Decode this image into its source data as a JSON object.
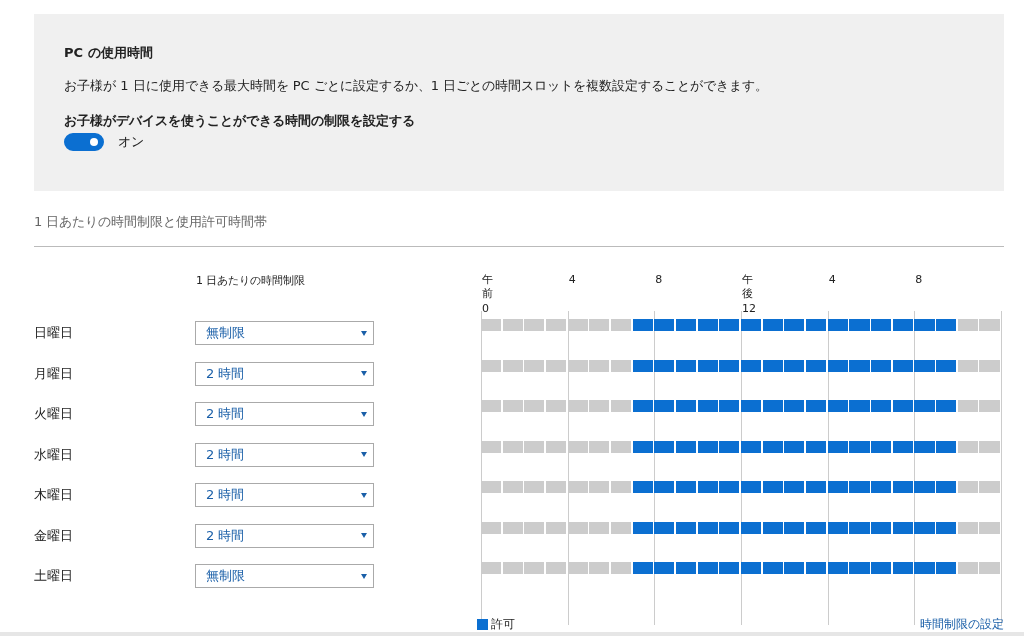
{
  "panel": {
    "title": "PC の使用時間",
    "description": "お子様が 1 日に使用できる最大時間を PC ごとに設定するか、1 日ごとの時間スロットを複数設定することができます。",
    "toggle_label": "お子様がデバイスを使うことができる時間の制限を設定する",
    "toggle": {
      "on": true,
      "state_text": "オン"
    }
  },
  "section_title": "1 日あたりの時間制限と使用許可時間帯",
  "limit_column_header": "1 日あたりの時間制限",
  "hour_ticks": [
    "午前0",
    "4",
    "8",
    "午後12",
    "4",
    "8"
  ],
  "days": [
    {
      "name": "日曜日",
      "limit": "無制限",
      "slots": [
        false,
        false,
        false,
        false,
        false,
        false,
        false,
        true,
        true,
        true,
        true,
        true,
        true,
        true,
        true,
        true,
        true,
        true,
        true,
        true,
        true,
        true,
        false,
        false
      ]
    },
    {
      "name": "月曜日",
      "limit": "2 時間",
      "slots": [
        false,
        false,
        false,
        false,
        false,
        false,
        false,
        true,
        true,
        true,
        true,
        true,
        true,
        true,
        true,
        true,
        true,
        true,
        true,
        true,
        true,
        true,
        false,
        false
      ]
    },
    {
      "name": "火曜日",
      "limit": "2 時間",
      "slots": [
        false,
        false,
        false,
        false,
        false,
        false,
        false,
        true,
        true,
        true,
        true,
        true,
        true,
        true,
        true,
        true,
        true,
        true,
        true,
        true,
        true,
        true,
        false,
        false
      ]
    },
    {
      "name": "水曜日",
      "limit": "2 時間",
      "slots": [
        false,
        false,
        false,
        false,
        false,
        false,
        false,
        true,
        true,
        true,
        true,
        true,
        true,
        true,
        true,
        true,
        true,
        true,
        true,
        true,
        true,
        true,
        false,
        false
      ]
    },
    {
      "name": "木曜日",
      "limit": "2 時間",
      "slots": [
        false,
        false,
        false,
        false,
        false,
        false,
        false,
        true,
        true,
        true,
        true,
        true,
        true,
        true,
        true,
        true,
        true,
        true,
        true,
        true,
        true,
        true,
        false,
        false
      ]
    },
    {
      "name": "金曜日",
      "limit": "2 時間",
      "slots": [
        false,
        false,
        false,
        false,
        false,
        false,
        false,
        true,
        true,
        true,
        true,
        true,
        true,
        true,
        true,
        true,
        true,
        true,
        true,
        true,
        true,
        true,
        false,
        false
      ]
    },
    {
      "name": "土曜日",
      "limit": "無制限",
      "slots": [
        false,
        false,
        false,
        false,
        false,
        false,
        false,
        true,
        true,
        true,
        true,
        true,
        true,
        true,
        true,
        true,
        true,
        true,
        true,
        true,
        true,
        true,
        false,
        false
      ]
    }
  ],
  "legend": {
    "label": "許可"
  },
  "settings_link": "時間制限の設定"
}
